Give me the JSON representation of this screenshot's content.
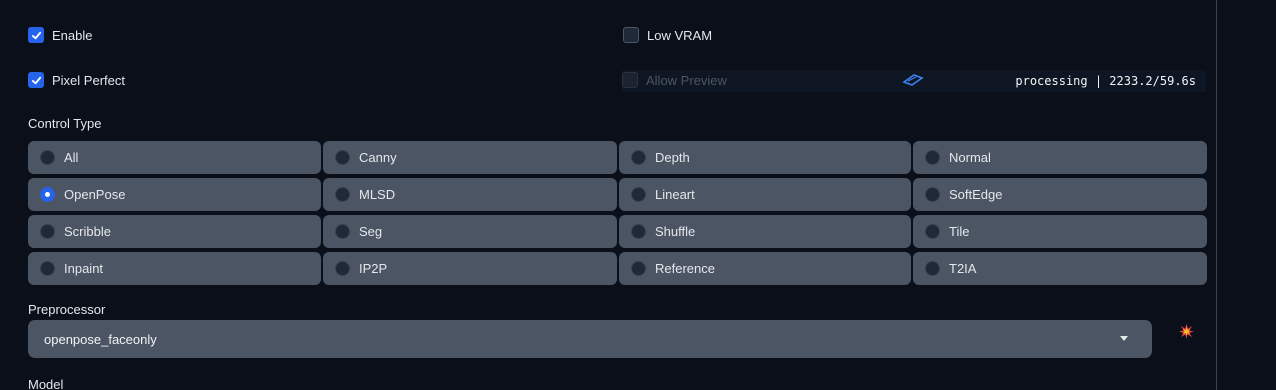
{
  "controls": {
    "enable": {
      "label": "Enable",
      "checked": true
    },
    "low_vram": {
      "label": "Low VRAM",
      "checked": false
    },
    "pixel_perfect": {
      "label": "Pixel Perfect",
      "checked": true
    },
    "allow_preview": {
      "label": "Allow Preview",
      "checked": false,
      "disabled": true
    }
  },
  "status": {
    "processing_text": "processing | 2233.2/59.6s"
  },
  "control_type": {
    "label": "Control Type",
    "selected": "OpenPose",
    "options": [
      "All",
      "Canny",
      "Depth",
      "Normal",
      "OpenPose",
      "MLSD",
      "Lineart",
      "SoftEdge",
      "Scribble",
      "Seg",
      "Shuffle",
      "Tile",
      "Inpaint",
      "IP2P",
      "Reference",
      "T2IA"
    ]
  },
  "preprocessor": {
    "label": "Preprocessor",
    "value": "openpose_faceonly"
  },
  "model": {
    "label": "Model"
  },
  "icons": {
    "run_preprocessor": "collision-icon",
    "spinner": "loading-icon"
  },
  "colors": {
    "accent": "#2563eb",
    "background": "#0b0f19",
    "panel": "#4b5563"
  }
}
